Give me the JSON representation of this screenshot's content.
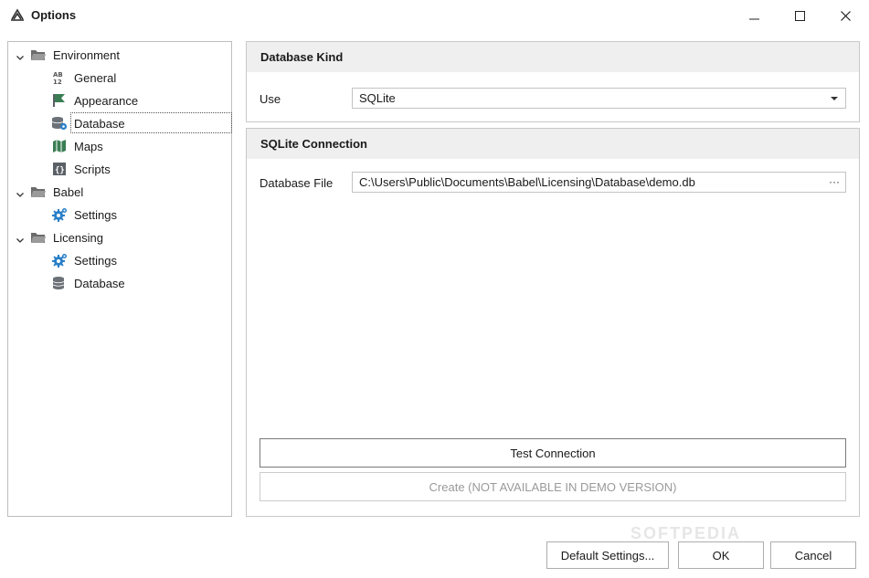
{
  "window": {
    "title": "Options",
    "minimize_icon": "minimize-icon",
    "maximize_icon": "maximize-icon",
    "close_icon": "close-icon"
  },
  "tree": {
    "items": [
      {
        "label": "Environment",
        "icon": "folder-icon",
        "level": 0,
        "expanded": true
      },
      {
        "label": "General",
        "icon": "ab12-icon",
        "level": 1
      },
      {
        "label": "Appearance",
        "icon": "flag-icon",
        "level": 1
      },
      {
        "label": "Database",
        "icon": "database-gear-icon",
        "level": 1,
        "selected": true
      },
      {
        "label": "Maps",
        "icon": "map-icon",
        "level": 1
      },
      {
        "label": "Scripts",
        "icon": "script-icon",
        "level": 1
      },
      {
        "label": "Babel",
        "icon": "folder-icon",
        "level": 0,
        "expanded": true
      },
      {
        "label": "Settings",
        "icon": "gear-icon",
        "level": 1
      },
      {
        "label": "Licensing",
        "icon": "folder-icon",
        "level": 0,
        "expanded": true
      },
      {
        "label": "Settings",
        "icon": "gear-icon",
        "level": 1
      },
      {
        "label": "Database",
        "icon": "database-icon",
        "level": 1
      }
    ]
  },
  "database_kind": {
    "header": "Database Kind",
    "use_label": "Use",
    "use_value": "SQLite"
  },
  "sqlite_connection": {
    "header": "SQLite Connection",
    "file_label": "Database File",
    "file_value": "C:\\Users\\Public\\Documents\\Babel\\Licensing\\Database\\demo.db",
    "browse_label": "···",
    "test_button": "Test Connection",
    "create_button": "Create (NOT AVAILABLE IN DEMO VERSION)"
  },
  "footer": {
    "default_settings": "Default Settings...",
    "ok": "OK",
    "cancel": "Cancel"
  },
  "watermark": "SOFTPEDIA",
  "colors": {
    "header_bg": "#efefef",
    "gear_blue": "#2a7fc8",
    "icon_green": "#3a7d54",
    "icon_gray": "#5a6066"
  }
}
